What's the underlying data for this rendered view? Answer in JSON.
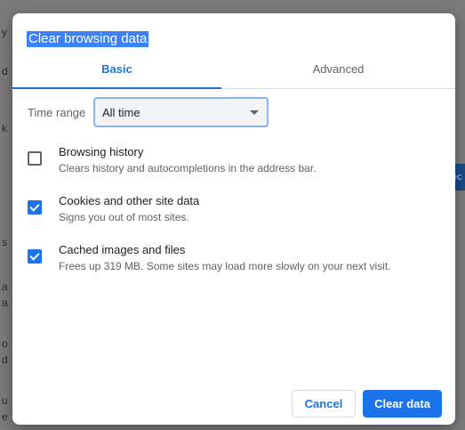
{
  "background": {
    "side_chars": [
      "y",
      "d",
      "k",
      "s",
      "a",
      "a",
      "o",
      "d",
      "u",
      "e"
    ],
    "pill_text": "ec"
  },
  "dialog": {
    "title": "Clear browsing data",
    "tabs": [
      {
        "label": "Basic",
        "selected": true
      },
      {
        "label": "Advanced",
        "selected": false
      }
    ],
    "time_range": {
      "label": "Time range",
      "value": "All time"
    },
    "options": [
      {
        "title": "Browsing history",
        "description": "Clears history and autocompletions in the address bar.",
        "checked": false
      },
      {
        "title": "Cookies and other site data",
        "description": "Signs you out of most sites.",
        "checked": true
      },
      {
        "title": "Cached images and files",
        "description": "Frees up 319 MB. Some sites may load more slowly on your next visit.",
        "checked": true
      }
    ],
    "buttons": {
      "cancel_label": "Cancel",
      "clear_label": "Clear data"
    }
  },
  "colors": {
    "accent": "#1a73e8",
    "title_highlight": "#3b82f6",
    "backdrop": "#6f6f6f"
  },
  "icons": {
    "dropdown": "dropdown-arrow-icon",
    "checked": "checkmark-icon"
  }
}
